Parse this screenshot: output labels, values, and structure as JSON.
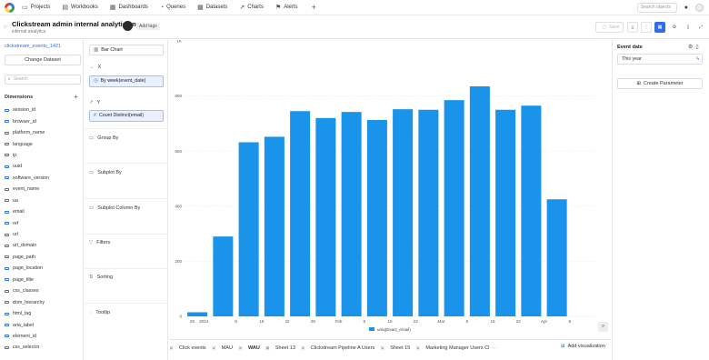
{
  "nav": {
    "items": [
      {
        "label": "Projects",
        "icon": "folder-icon"
      },
      {
        "label": "Workbooks",
        "icon": "workbook-icon"
      },
      {
        "label": "Dashboards",
        "icon": "dashboard-icon"
      },
      {
        "label": "Queries",
        "icon": "query-icon"
      },
      {
        "label": "Datasets",
        "icon": "dataset-icon"
      },
      {
        "label": "Charts",
        "icon": "chart-icon"
      },
      {
        "label": "Alerts",
        "icon": "alert-icon"
      }
    ],
    "search_placeholder": "Search objects"
  },
  "header": {
    "title": "Clickstream admin internal analytics new",
    "subtitle": "internal analytics",
    "add_tags": "Add tags",
    "save_label": "Save"
  },
  "sidebar": {
    "dataset_name": "clickstream_events_1421",
    "change_dataset": "Change Dataset",
    "search_placeholder": "Search",
    "dimensions_title": "Dimensions",
    "dimensions": [
      "session_id",
      "browser_id",
      "platform_name",
      "language",
      "ip",
      "uuid",
      "software_version",
      "event_name",
      "ua",
      "email",
      "ref",
      "url",
      "url_domain",
      "page_path",
      "page_location",
      "page_title",
      "css_classes",
      "dom_hierarchy",
      "html_tag",
      "aria_label",
      "element_id",
      "css_selector"
    ]
  },
  "config": {
    "chart_type": "Bar Chart",
    "x_label": "X",
    "x_field": "By week(event_date)",
    "y_label": "Y",
    "y_field": "Count Distinct(email)",
    "sections": [
      "Group By",
      "Subplot By",
      "Subplot Column By",
      "Filters",
      "Sorting",
      "Tooltip"
    ]
  },
  "chart_data": {
    "type": "bar",
    "categories": [
      "2023-12-25",
      "2024-01-01",
      "2024-01-08",
      "2024-01-15",
      "2024-01-22",
      "2024-01-29",
      "2024-02-05",
      "2024-02-12",
      "2024-02-19",
      "2024-02-26",
      "2024-03-04",
      "2024-03-11",
      "2024-03-18",
      "2024-03-25",
      "2024-04-01",
      "2024-04-08"
    ],
    "values": [
      15,
      290,
      632,
      652,
      745,
      720,
      742,
      713,
      752,
      750,
      785,
      835,
      750,
      765,
      425,
      0
    ],
    "series_name": "uniq(Exact_email)",
    "ylim": [
      0,
      1000
    ],
    "yticks": [
      "0",
      "200",
      "400",
      "600",
      "800",
      "1K"
    ],
    "xticks": [
      "25",
      "2024",
      "8",
      "15",
      "22",
      "29",
      "Feb",
      "8",
      "15",
      "22",
      "Mar",
      "8",
      "15",
      "22",
      "Apr",
      "8"
    ],
    "color": "#1a94ea",
    "legend": "bottom"
  },
  "tabs": [
    {
      "label": "Click events",
      "active": false
    },
    {
      "label": "MAU",
      "active": false
    },
    {
      "label": "WAU",
      "active": true
    },
    {
      "label": "Sheet 13",
      "active": false
    },
    {
      "label": "Clickstream Pipeline A Users",
      "active": false
    },
    {
      "label": "Sheet 15",
      "active": false
    },
    {
      "label": "Marketing Manager Users Cl",
      "active": false
    }
  ],
  "tabs_more": "···",
  "add_visualization": "Add visualization",
  "right_panel": {
    "filter_label": "Event date",
    "filter_value": "This year",
    "create_parameter": "Create Parameter"
  },
  "colors": {
    "accent": "#2f6fe4",
    "bar": "#1a94ea"
  }
}
